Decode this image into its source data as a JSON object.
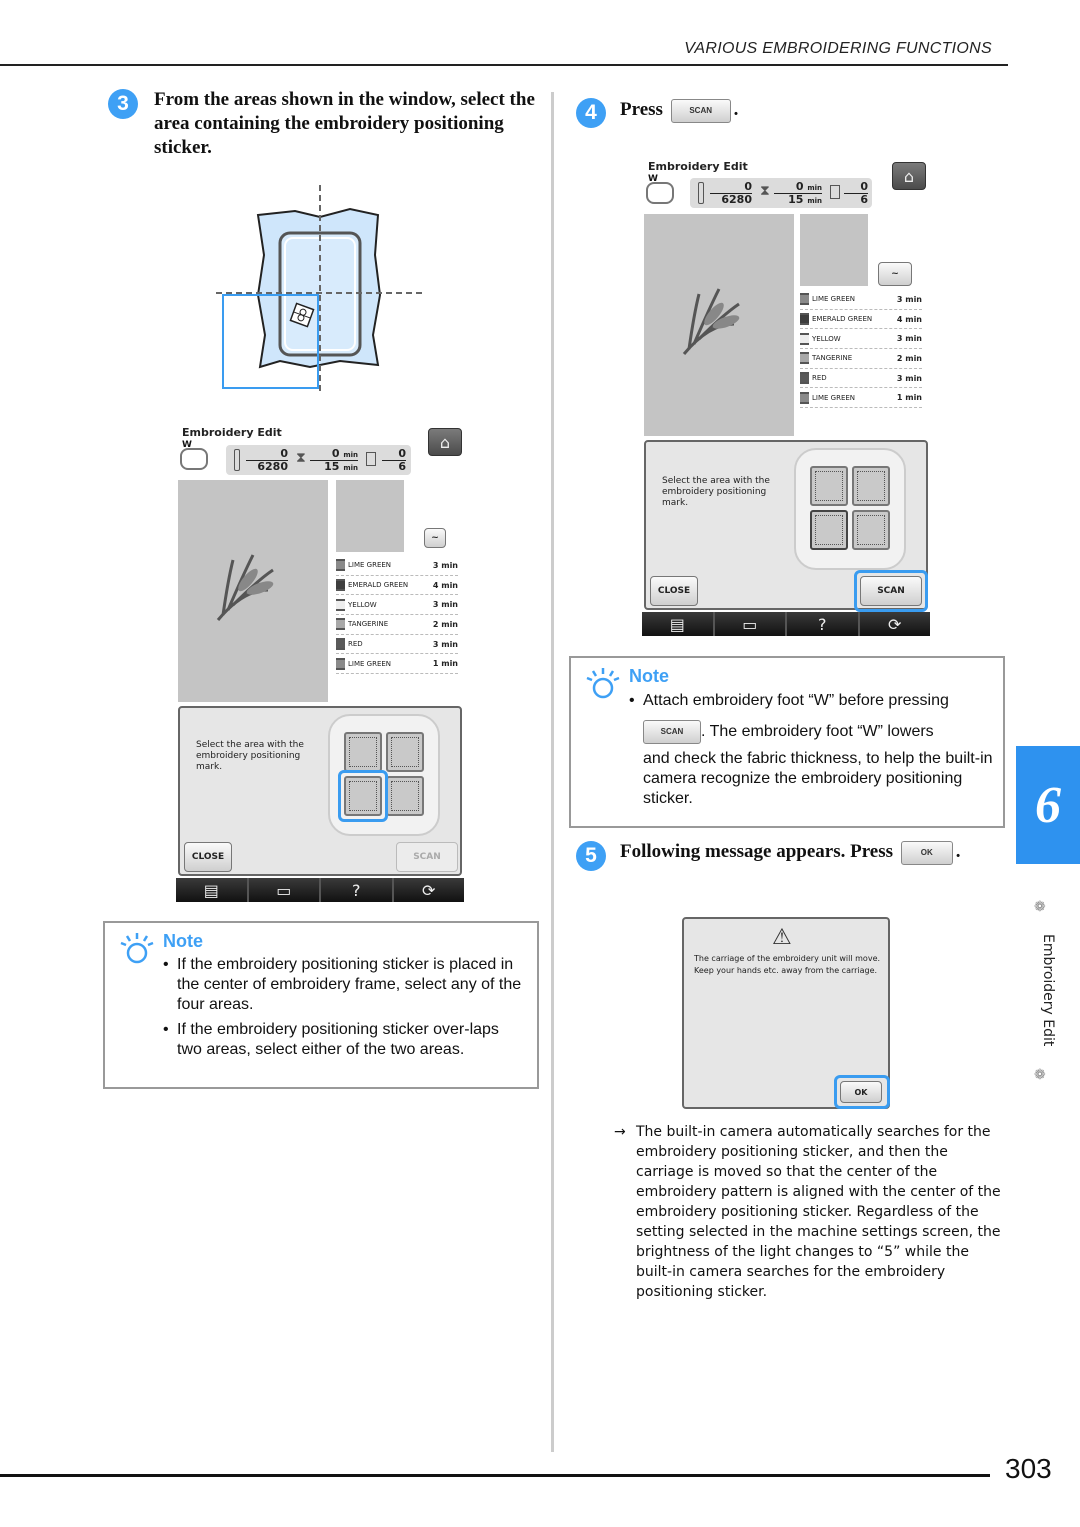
{
  "header": {
    "section_title": "VARIOUS EMBROIDERING FUNCTIONS"
  },
  "steps": [
    {
      "number": "3",
      "text": "From the areas shown in the window, select the area containing the embroidery positioning sticker."
    },
    {
      "number": "4",
      "text_before": "Press",
      "button_label": "SCAN",
      "text_after": "."
    },
    {
      "number": "5",
      "text_before": "Following message appears. Press",
      "button_label": "OK",
      "text_after": "."
    }
  ],
  "screen": {
    "title": "Embroidery Edit",
    "foot_label": "W",
    "stitch_current": "0",
    "stitch_total": "6280",
    "time_current": "0",
    "time_total": "15",
    "time_unit": "min",
    "color_current": "0",
    "color_total": "6",
    "threads": [
      {
        "name": "LIME GREEN",
        "time": "3 min",
        "color": "#8a8a8a"
      },
      {
        "name": "EMERALD GREEN",
        "time": "4 min",
        "color": "#3e3e3e"
      },
      {
        "name": "YELLOW",
        "time": "3 min",
        "color": "#ededed"
      },
      {
        "name": "TANGERINE",
        "time": "2 min",
        "color": "#a8a8a8"
      },
      {
        "name": "RED",
        "time": "3 min",
        "color": "#5a5a5a"
      },
      {
        "name": "LIME GREEN",
        "time": "1 min",
        "color": "#8a8a8a"
      }
    ],
    "dialog_message": "Select the area with the embroidery positioning mark.",
    "close_label": "CLOSE",
    "scan_label": "SCAN",
    "taskbar": [
      "page-icon",
      "machine-icon",
      "?",
      "settings-icon"
    ]
  },
  "warning_dialog": {
    "message": "The carriage of the embroidery unit will move. Keep your hands etc. away from the carriage.",
    "ok_label": "OK"
  },
  "notes": {
    "title": "Note",
    "left_items": [
      "If the embroidery positioning sticker is placed in the center of embroidery frame, select any of the four areas.",
      "If the embroidery positioning sticker over-laps two areas, select either of the two areas."
    ],
    "right_line1": "Attach embroidery foot “W” before pressing",
    "right_button": "SCAN",
    "right_line2": ". The embroidery foot “W” lowers",
    "right_line3": "and check the fabric thickness, to help the built-in camera recognize the embroidery positioning sticker."
  },
  "result_text": "The built-in camera automatically searches for the embroidery positioning sticker, and then the carriage is moved so that the center of the embroidery pattern is aligned with the center of the embroidery positioning sticker. Regardless of the setting selected in the machine settings screen, the brightness of the light changes to “5” while the built-in camera searches for the embroidery positioning sticker.",
  "result_arrow": "→",
  "sidebar": {
    "chapter": "6",
    "label": "Embroidery Edit"
  },
  "footer": {
    "page_number": "303"
  },
  "colors": {
    "accent": "#3ea0f5",
    "chapter_tab": "#2e92ef"
  }
}
